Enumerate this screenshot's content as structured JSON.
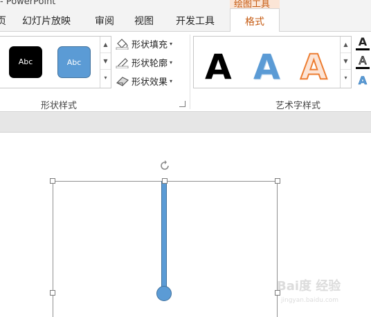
{
  "title_bar": {
    "app_title": "- PowerPoint"
  },
  "contextual_tab_header": "绘图工具",
  "tabs": [
    {
      "label": "页"
    },
    {
      "label": "幻灯片放映"
    },
    {
      "label": "审阅"
    },
    {
      "label": "视图"
    },
    {
      "label": "开发工具"
    },
    {
      "label": "格式",
      "active": true
    }
  ],
  "ribbon": {
    "shape_styles": {
      "group_label": "形状样式",
      "samples": [
        {
          "text": "Abc",
          "fill": "#000000"
        },
        {
          "text": "Abc",
          "fill": "#5b9bd5"
        }
      ],
      "commands": [
        {
          "label": "形状填充",
          "icon": "paint-bucket-icon"
        },
        {
          "label": "形状轮廓",
          "icon": "pencil-icon"
        },
        {
          "label": "形状效果",
          "icon": "eraser-shape-icon"
        }
      ]
    },
    "wordart_styles": {
      "group_label": "艺术字样式",
      "samples": [
        {
          "text": "A",
          "style": "black-fill"
        },
        {
          "text": "A",
          "style": "blue-gradient"
        },
        {
          "text": "A",
          "style": "orange-outline"
        }
      ],
      "format_buttons": [
        {
          "text": "A",
          "icon": "text-fill-icon"
        },
        {
          "text": "A",
          "icon": "text-outline-icon"
        },
        {
          "text": "A",
          "icon": "text-effects-icon"
        }
      ]
    }
  },
  "colors": {
    "accent_orange": "#c55a11",
    "shape_blue": "#5b9bd5",
    "shape_blue_border": "#41719c"
  },
  "watermark": {
    "main": "Bai度 经验",
    "sub": "jingyan.baidu.com"
  }
}
